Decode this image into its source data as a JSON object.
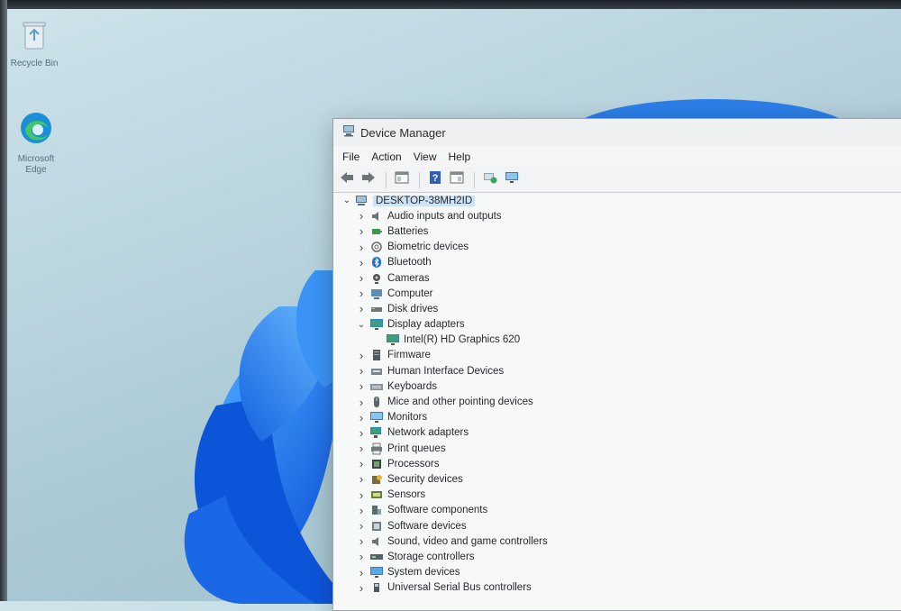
{
  "desktop": {
    "icons": [
      {
        "label": "Recycle Bin",
        "icon": "recycle-bin-icon"
      },
      {
        "label": "Microsoft Edge",
        "icon": "edge-icon"
      }
    ]
  },
  "window": {
    "title": "Device Manager",
    "menu": [
      "File",
      "Action",
      "View",
      "Help"
    ],
    "toolbar": [
      {
        "name": "back-button",
        "icon": "arrow-left-icon"
      },
      {
        "name": "forward-button",
        "icon": "arrow-right-icon"
      },
      {
        "name": "show-hide-console-tree-button",
        "icon": "console-tree-icon"
      },
      {
        "name": "help-button",
        "icon": "help-icon"
      },
      {
        "name": "properties-button",
        "icon": "properties-icon"
      },
      {
        "name": "scan-hardware-button",
        "icon": "scan-hardware-icon"
      },
      {
        "name": "update-driver-button",
        "icon": "monitor-icon"
      }
    ],
    "tree": {
      "root": {
        "label": "DESKTOP-38MH2ID",
        "icon": "computer-icon",
        "expanded": true
      },
      "categories": [
        {
          "label": "Audio inputs and outputs",
          "icon": "speaker-icon",
          "expanded": false
        },
        {
          "label": "Batteries",
          "icon": "battery-icon",
          "expanded": false
        },
        {
          "label": "Biometric devices",
          "icon": "fingerprint-icon",
          "expanded": false
        },
        {
          "label": "Bluetooth",
          "icon": "bluetooth-icon",
          "expanded": false
        },
        {
          "label": "Cameras",
          "icon": "camera-icon",
          "expanded": false
        },
        {
          "label": "Computer",
          "icon": "computer-icon",
          "expanded": false
        },
        {
          "label": "Disk drives",
          "icon": "disk-drive-icon",
          "expanded": false
        },
        {
          "label": "Display adapters",
          "icon": "display-adapter-icon",
          "expanded": true,
          "children": [
            {
              "label": "Intel(R) HD Graphics 620",
              "icon": "display-adapter-icon"
            }
          ]
        },
        {
          "label": "Firmware",
          "icon": "firmware-icon",
          "expanded": false
        },
        {
          "label": "Human Interface Devices",
          "icon": "hid-icon",
          "expanded": false
        },
        {
          "label": "Keyboards",
          "icon": "keyboard-icon",
          "expanded": false
        },
        {
          "label": "Mice and other pointing devices",
          "icon": "mouse-icon",
          "expanded": false
        },
        {
          "label": "Monitors",
          "icon": "monitor-icon",
          "expanded": false
        },
        {
          "label": "Network adapters",
          "icon": "network-icon",
          "expanded": false
        },
        {
          "label": "Print queues",
          "icon": "printer-icon",
          "expanded": false
        },
        {
          "label": "Processors",
          "icon": "processor-icon",
          "expanded": false
        },
        {
          "label": "Security devices",
          "icon": "security-icon",
          "expanded": false
        },
        {
          "label": "Sensors",
          "icon": "sensor-icon",
          "expanded": false
        },
        {
          "label": "Software components",
          "icon": "software-component-icon",
          "expanded": false
        },
        {
          "label": "Software devices",
          "icon": "software-device-icon",
          "expanded": false
        },
        {
          "label": "Sound, video and game controllers",
          "icon": "speaker-icon",
          "expanded": false
        },
        {
          "label": "Storage controllers",
          "icon": "storage-icon",
          "expanded": false
        },
        {
          "label": "System devices",
          "icon": "system-icon",
          "expanded": false
        },
        {
          "label": "Universal Serial Bus controllers",
          "icon": "usb-icon",
          "expanded": false
        }
      ]
    }
  },
  "colors": {
    "selection": "#cfe3f7",
    "window_bg": "#f7f8f8",
    "accent_blue": "#1f6fd1"
  }
}
